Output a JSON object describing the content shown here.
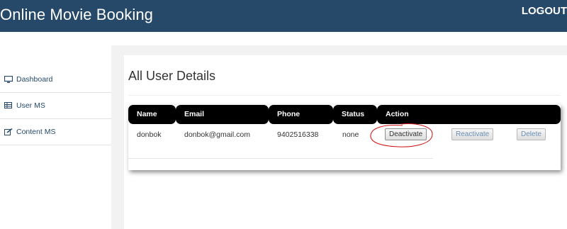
{
  "header": {
    "title": "Online Movie Booking",
    "logout_label": "LOGOUT",
    "bg_color": "#26496a"
  },
  "sidebar": {
    "items": [
      {
        "label": "Dashboard",
        "icon": "monitor-icon"
      },
      {
        "label": "User MS",
        "icon": "table-icon"
      },
      {
        "label": "Content MS",
        "icon": "edit-icon"
      }
    ]
  },
  "main": {
    "title": "All User Details",
    "table": {
      "headers": [
        "Name",
        "Email",
        "Phone",
        "Status",
        "Action"
      ],
      "rows": [
        {
          "name": "donbok",
          "email": "donbok@gmail.com",
          "phone": "9402516338",
          "status": "none",
          "actions": {
            "deactivate": "Deactivate",
            "reactivate": "Reactivate",
            "delete": "Delete"
          }
        }
      ]
    }
  }
}
